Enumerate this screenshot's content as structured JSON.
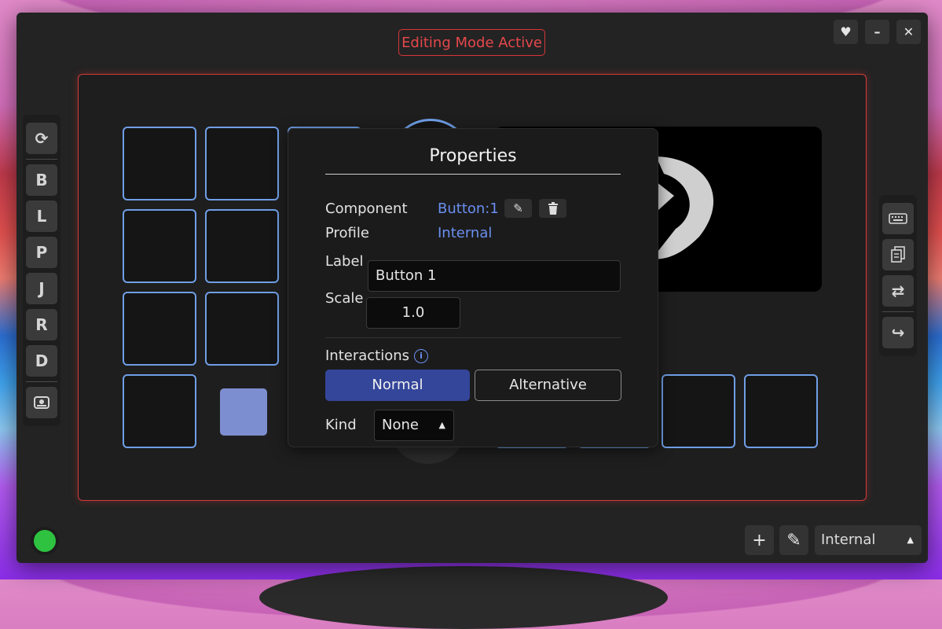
{
  "window": {
    "mode_badge": "Editing Mode Active",
    "controls": [
      "heart-icon",
      "minimize-icon",
      "close-icon"
    ]
  },
  "left_toolbar": {
    "top_icon": "refresh-icon",
    "letters": [
      "B",
      "L",
      "P",
      "J",
      "R",
      "D"
    ],
    "bottom_icon": "drive-icon"
  },
  "right_toolbar": {
    "icons": [
      "keyboard-icon",
      "copy-icon",
      "swap-icon",
      "share-icon"
    ]
  },
  "properties": {
    "title": "Properties",
    "component_label": "Component",
    "component_value": "Button:1",
    "profile_label": "Profile",
    "profile_value": "Internal",
    "label_label": "Label",
    "label_value": "Button 1",
    "scale_label": "Scale",
    "scale_value": "1.0",
    "interactions_label": "Interactions",
    "tabs": [
      "Normal",
      "Alternative"
    ],
    "kind_label": "Kind",
    "kind_value": "None"
  },
  "bottom_bar": {
    "profile_select": "Internal"
  },
  "colors": {
    "accent_red": "#d8353a",
    "accent_blue": "#6f9ee6",
    "link_blue": "#6a8ff0",
    "status_green": "#2ec240",
    "active_tab": "#34469a"
  }
}
